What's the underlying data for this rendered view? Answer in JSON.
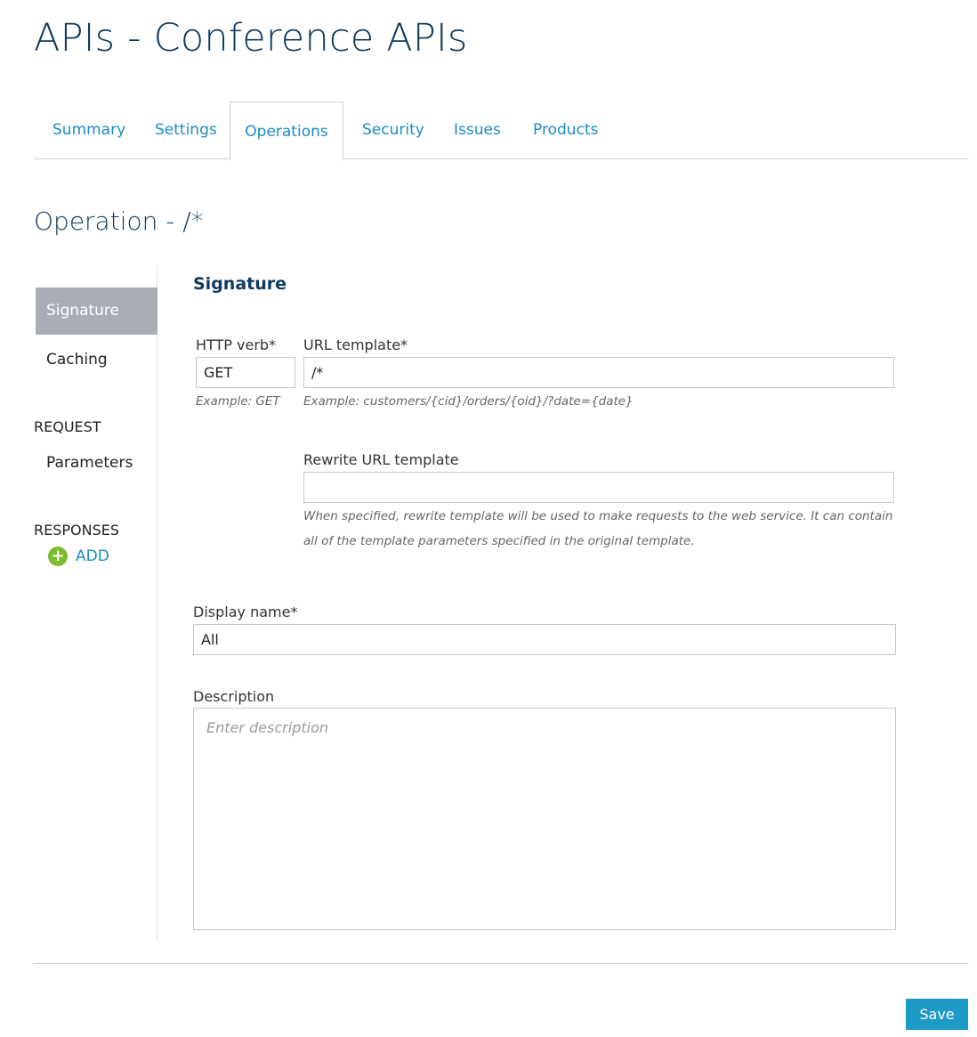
{
  "page": {
    "title": "APIs - Conference APIs"
  },
  "tabs": [
    {
      "label": "Summary"
    },
    {
      "label": "Settings"
    },
    {
      "label": "Operations"
    },
    {
      "label": "Security"
    },
    {
      "label": "Issues"
    },
    {
      "label": "Products"
    }
  ],
  "active_tab": "Operations",
  "operation": {
    "title": "Operation - /*"
  },
  "sidebar": {
    "items": [
      {
        "label": "Signature",
        "active": true
      },
      {
        "label": "Caching"
      }
    ],
    "request_heading": "REQUEST",
    "request_items": [
      {
        "label": "Parameters"
      }
    ],
    "responses_heading": "RESPONSES",
    "add_label": "ADD"
  },
  "signature": {
    "title": "Signature",
    "http_verb": {
      "label": "HTTP verb*",
      "value": "GET",
      "hint": "Example: GET"
    },
    "url_template": {
      "label": "URL template*",
      "value": "/*",
      "hint": "Example: customers/{cid}/orders/{oid}/?date={date}"
    },
    "rewrite_url": {
      "label": "Rewrite URL template",
      "value": "",
      "hint": "When specified, rewrite template will be used to make requests to the web service. It can contain all of the template parameters specified in the original template."
    },
    "display_name": {
      "label": "Display name*",
      "value": "All"
    },
    "description": {
      "label": "Description",
      "value": "",
      "placeholder": "Enter description"
    }
  },
  "actions": {
    "save_label": "Save"
  },
  "colors": {
    "accent": "#1e9ac7",
    "title": "#0e3a5e",
    "link": "#1b8dc2",
    "add_icon": "#7cbb2e",
    "active_side": "#a9aeb6"
  }
}
